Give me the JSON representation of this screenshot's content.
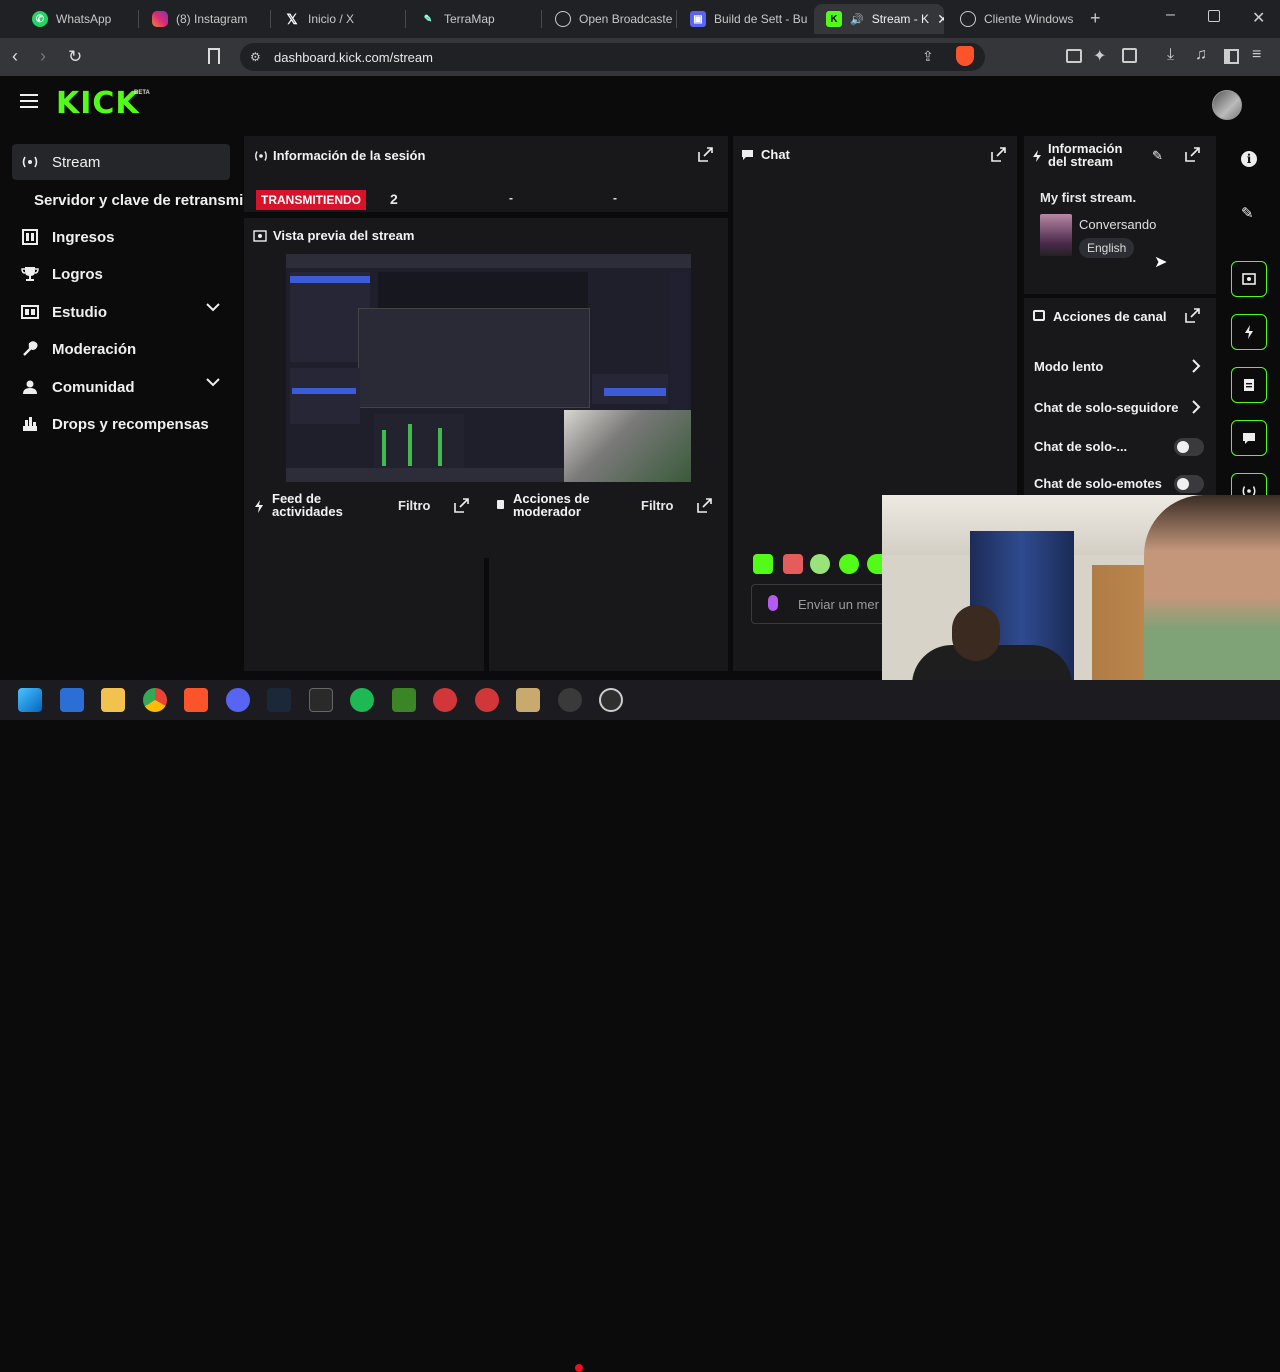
{
  "browser": {
    "tabs": [
      {
        "label": "WhatsApp",
        "icon": "whatsapp-icon"
      },
      {
        "label": "(8) Instagram",
        "icon": "instagram-icon"
      },
      {
        "label": "Inicio / X",
        "icon": "x-icon"
      },
      {
        "label": "TerraMap",
        "icon": "terramap-icon"
      },
      {
        "label": "Open Broadcaste",
        "icon": "obs-icon"
      },
      {
        "label": "Build de Sett - Bu",
        "icon": "discord-icon"
      },
      {
        "label": "Stream - K",
        "icon": "kick-icon"
      },
      {
        "label": "Cliente Windows",
        "icon": "obs-icon"
      }
    ],
    "url": "dashboard.kick.com/stream"
  },
  "brand": {
    "logo": "KICK",
    "badge": "BETA",
    "accent": "#53fc18"
  },
  "sidebar": {
    "items": [
      {
        "label": "Stream",
        "icon": "broadcast-icon"
      },
      {
        "label": "Servidor y clave de retransmi",
        "icon": ""
      },
      {
        "label": "Ingresos",
        "icon": "bank-icon"
      },
      {
        "label": "Logros",
        "icon": "trophy-icon"
      },
      {
        "label": "Estudio",
        "icon": "studio-icon"
      },
      {
        "label": "Moderación",
        "icon": "wrench-icon"
      },
      {
        "label": "Comunidad",
        "icon": "users-icon"
      },
      {
        "label": "Drops y recompensas",
        "icon": "gift-icon"
      }
    ]
  },
  "session": {
    "title": "Información de la sesión",
    "status_badge": "TRANSMITIENDO",
    "viewers": "2",
    "stat2": "-",
    "stat3": "-"
  },
  "preview": {
    "title": "Vista previa del stream"
  },
  "chat": {
    "title": "Chat",
    "placeholder": "Enviar un mer"
  },
  "activity": {
    "title_line1": "Feed de",
    "title_line2": "actividades",
    "filter": "Filtro"
  },
  "modactions": {
    "title_line1": "Acciones de",
    "title_line2": "moderador",
    "filter": "Filtro"
  },
  "stream_info": {
    "title_line1": "Información",
    "title_line2": "del stream",
    "stream_title": "My first stream.",
    "category": "Conversando",
    "language": "English"
  },
  "channel_actions": {
    "title": "Acciones de canal",
    "slow_mode": "Modo lento",
    "followers_only": "Chat de solo-seguidore",
    "subs_only": "Chat de solo-...",
    "emotes_only": "Chat de solo-emotes"
  }
}
